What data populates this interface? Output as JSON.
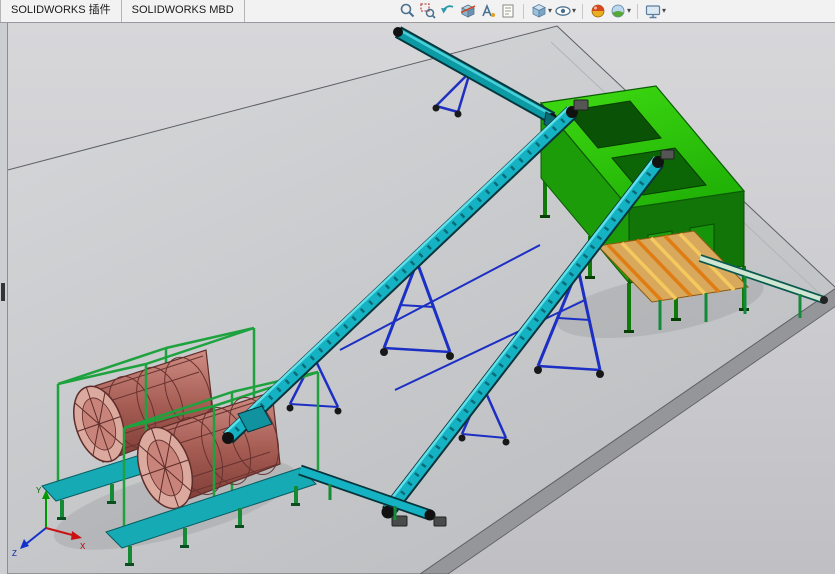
{
  "tab_bar": {
    "tabs": [
      {
        "label": "SOLIDWORKS 插件"
      },
      {
        "label": "SOLIDWORKS MBD"
      }
    ]
  },
  "toolbar": {
    "dropdown_glyph": "▾",
    "icons": [
      {
        "name": "zoom-to-fit-icon",
        "has_dropdown": false
      },
      {
        "name": "zoom-to-area-icon",
        "has_dropdown": false
      },
      {
        "name": "previous-view-icon",
        "has_dropdown": false
      },
      {
        "name": "section-view-icon",
        "has_dropdown": false
      },
      {
        "name": "annotation-view-icon",
        "has_dropdown": false
      },
      {
        "name": "comment-icon",
        "has_dropdown": false
      },
      {
        "name": "view-orientation-icon",
        "has_dropdown": true
      },
      {
        "name": "hide-show-items-icon",
        "has_dropdown": true
      },
      {
        "name": "edit-appearance-icon",
        "has_dropdown": false
      },
      {
        "name": "apply-scene-icon",
        "has_dropdown": true
      },
      {
        "name": "view-settings-icon",
        "has_dropdown": true
      }
    ]
  },
  "viewport": {
    "triad": {
      "x_label": "X",
      "y_label": "Y",
      "z_label": "Z"
    },
    "colors": {
      "background_gray": "#cfcfd3",
      "platform_gray": "#c6c8cb",
      "conveyor_teal": "#14b2c2",
      "machine_green": "#2fd00d",
      "drum_red": "#b06a60",
      "truss_blue": "#1c2fc4",
      "stand_green": "#148a34",
      "roller_orange": "#e8981e"
    }
  }
}
